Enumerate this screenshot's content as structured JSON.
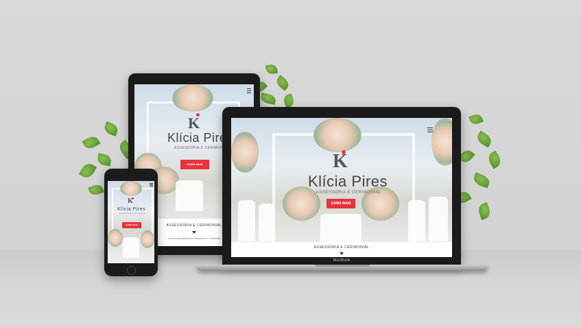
{
  "site": {
    "brand": "Klícia Pires",
    "tagline": "ASSESSORIA E CERIMONIAL",
    "cta": "SAIBA MAIS",
    "section": "ASSESSORIA E CERIMONIAL",
    "intro_snippet": "...somos especialistas em Assessoria e Cerimonial...",
    "accent_color": "#e8323c"
  },
  "laptop": {
    "label": "MacBook"
  },
  "icons": {
    "menu": "hamburger-menu-icon",
    "scroll": "triangle-down-icon",
    "logo": "k-monogram-icon"
  }
}
